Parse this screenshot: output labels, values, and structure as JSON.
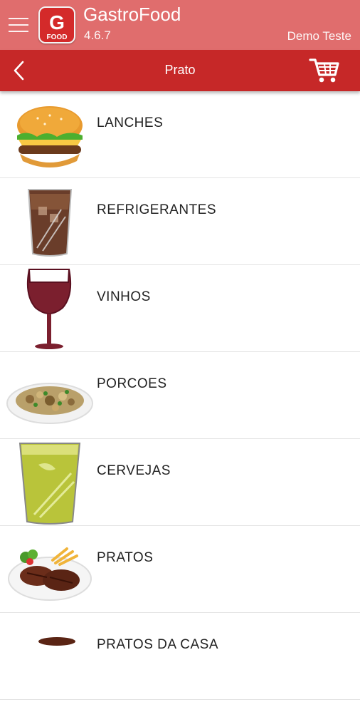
{
  "app": {
    "name": "GastroFood",
    "version": "4.6.7",
    "user": "Demo Teste",
    "logo_letter": "G",
    "logo_word": "FOOD"
  },
  "toolbar": {
    "title": "Prato"
  },
  "categories": [
    {
      "label": "LANCHES",
      "icon": "burger-icon"
    },
    {
      "label": "REFRIGERANTES",
      "icon": "soda-glass-icon"
    },
    {
      "label": "VINHOS",
      "icon": "wine-glass-icon"
    },
    {
      "label": "PORCOES",
      "icon": "snack-plate-icon"
    },
    {
      "label": "CERVEJAS",
      "icon": "beer-glass-icon"
    },
    {
      "label": "PRATOS",
      "icon": "steak-plate-icon"
    },
    {
      "label": "PRATOS DA CASA",
      "icon": "house-dish-icon"
    }
  ],
  "colors": {
    "appbar": "#e06d6d",
    "toolbar": "#c62828",
    "logo": "#d42a2a"
  }
}
